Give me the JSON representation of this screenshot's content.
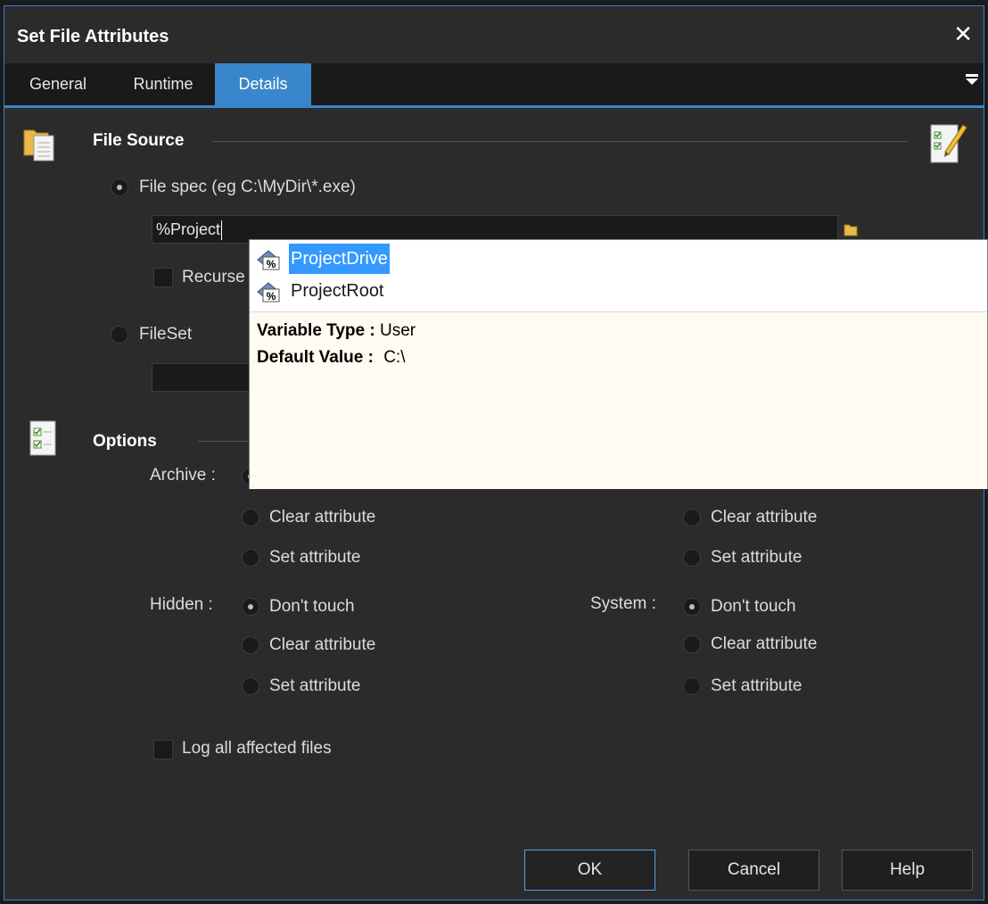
{
  "window": {
    "title": "Set File Attributes"
  },
  "tabs": [
    {
      "label": "General"
    },
    {
      "label": "Runtime"
    },
    {
      "label": "Details",
      "active": true
    }
  ],
  "file_source": {
    "header": "File Source",
    "filespec_label": "File spec (eg C:\\MyDir\\*.exe)",
    "filespec_value": "%Project",
    "recurse_label": "Recurse",
    "fileset_label": "FileSet",
    "fileset_value": ""
  },
  "autocomplete": {
    "items": [
      {
        "label": "ProjectDrive",
        "selected": true,
        "icon": "variable-icon"
      },
      {
        "label": "ProjectRoot",
        "selected": false,
        "icon": "variable-icon"
      }
    ],
    "detail": {
      "type_label": "Variable Type :",
      "type_value": "User",
      "default_label": "Default Value :",
      "default_value": "C:\\"
    }
  },
  "options": {
    "header": "Options",
    "archive_label": "Archive :",
    "hidden_label": "Hidden :",
    "system_label": "System :",
    "dont_touch": "Don't touch",
    "clear_attr": "Clear attribute",
    "set_attr": "Set attribute",
    "log_label": "Log all affected files"
  },
  "buttons": {
    "ok": "OK",
    "cancel": "Cancel",
    "help": "Help"
  },
  "colors": {
    "accent": "#3a86cc",
    "background": "#2b2b2b",
    "selection": "#3399ff"
  }
}
